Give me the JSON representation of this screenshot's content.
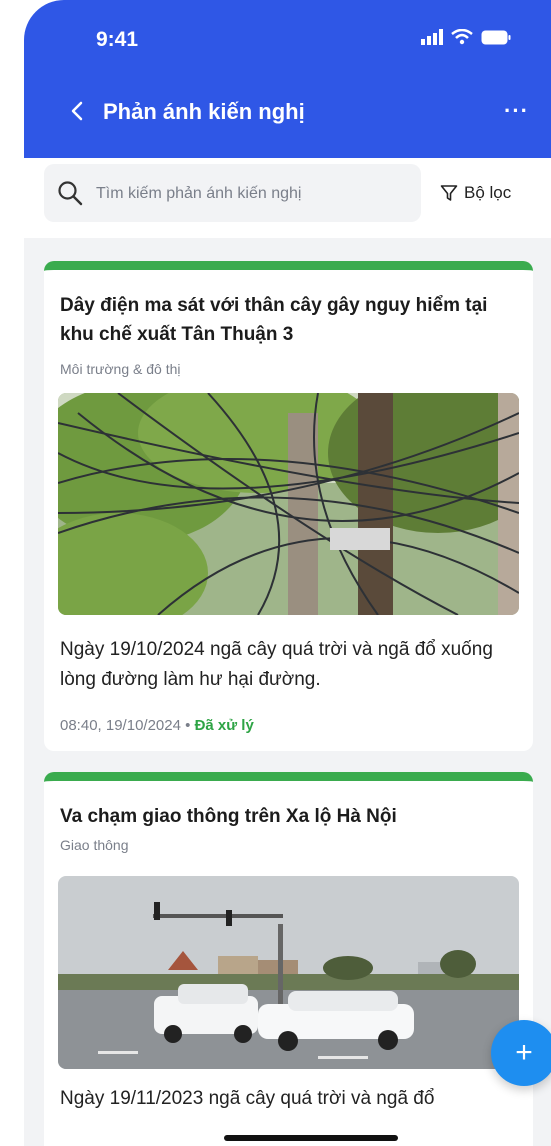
{
  "status_bar": {
    "time": "9:41"
  },
  "nav": {
    "back_icon": "chevron-left-icon",
    "title": "Phản ánh kiến nghị",
    "more": "···"
  },
  "search": {
    "placeholder": "Tìm kiếm phản ánh kiến nghị",
    "value": "",
    "filter_label": "Bộ lọc"
  },
  "colors": {
    "primary": "#2f57e6",
    "accent_green": "#3aab4e",
    "fab": "#1e8ef0"
  },
  "reports": [
    {
      "title": "Dây điện ma sát với thân cây gây nguy hiểm tại khu chế xuất Tân Thuận 3",
      "category": "Môi trường & đô thị",
      "image": "tangled-wires-tree-photo",
      "description": "Ngày 19/10/2024 ngã cây quá trời và ngã đổ xuống lòng đường làm hư hại đường.",
      "time": "08:40, 19/10/2024",
      "separator": "•",
      "status": "Đã xử lý"
    },
    {
      "title": "Va chạm giao thông trên Xa lộ Hà Nội",
      "category": "Giao thông",
      "image": "car-collision-intersection-photo",
      "description": "Ngày 19/11/2023 ngã cây quá trời và ngã đổ"
    }
  ],
  "fab": {
    "label": "+"
  }
}
